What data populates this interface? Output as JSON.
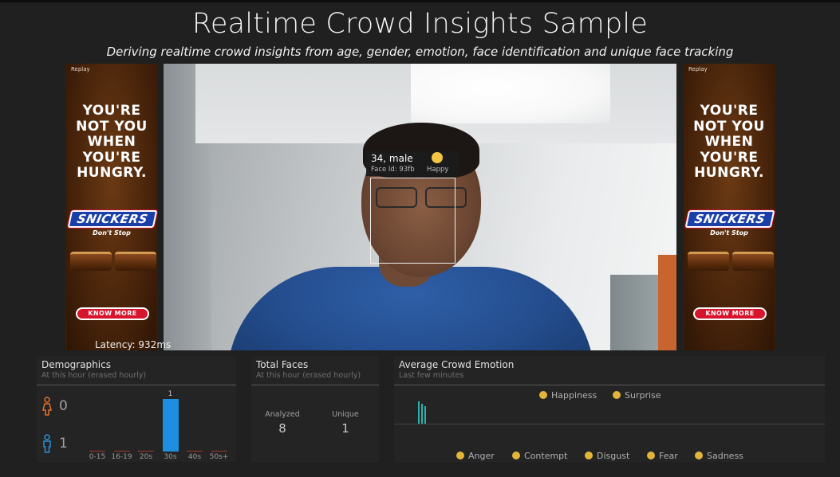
{
  "header": {
    "title": "Realtime Crowd Insights Sample",
    "subtitle": "Deriving realtime crowd insights from age, gender, emotion, face identification and unique face tracking"
  },
  "ads": {
    "replay": "Replay",
    "headline": "YOU'RE NOT YOU WHEN YOU'RE HUNGRY.",
    "brand": "SNICKERS",
    "tagline": "Don't Stop",
    "cta": "KNOW MORE"
  },
  "video": {
    "face": {
      "age_gender": "34, male",
      "face_id": "Face Id: 93fb",
      "emotion": "Happy"
    },
    "latency": "Latency: 932ms"
  },
  "demographics": {
    "title": "Demographics",
    "subtitle": "At this hour (erased hourly)",
    "female_count": "0",
    "male_count": "1",
    "colors": {
      "female": "#e2702f",
      "male": "#2b8fd6",
      "bar": "#1e8fe0"
    }
  },
  "total_faces": {
    "title": "Total Faces",
    "subtitle": "At this hour (erased hourly)",
    "analyzed_label": "Analyzed",
    "analyzed_value": "8",
    "unique_label": "Unique",
    "unique_value": "1"
  },
  "emotion": {
    "title": "Average Crowd Emotion",
    "subtitle": "Last few minutes",
    "top_legend": [
      "Happiness",
      "Surprise"
    ],
    "bottom_legend": [
      "Anger",
      "Contempt",
      "Disgust",
      "Fear",
      "Sadness"
    ]
  },
  "chart_data": {
    "type": "bar",
    "categories": [
      "0-15",
      "16-19",
      "20s",
      "30s",
      "40s",
      "50s+"
    ],
    "values": [
      0,
      0,
      0,
      1,
      0,
      0
    ],
    "ylim": [
      0,
      1
    ],
    "data_labels": [
      "",
      "",
      "",
      "1",
      "",
      ""
    ]
  }
}
